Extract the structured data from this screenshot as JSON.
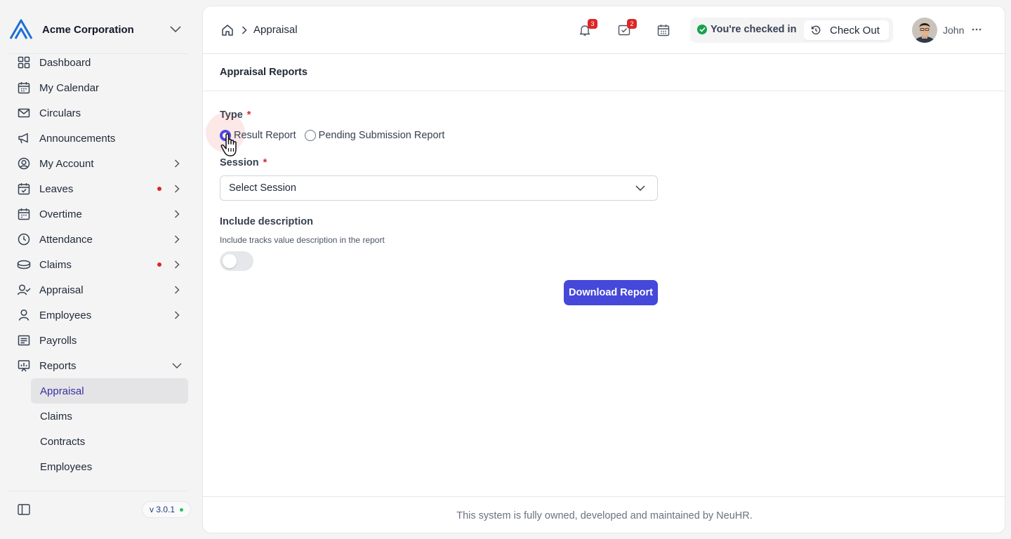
{
  "sidebar": {
    "org_name": "Acme Corporation",
    "items": [
      {
        "label": "Dashboard",
        "icon": "dashboard-icon"
      },
      {
        "label": "My Calendar",
        "icon": "calendar-icon"
      },
      {
        "label": "Circulars",
        "icon": "mail-icon"
      },
      {
        "label": "Announcements",
        "icon": "megaphone-icon"
      },
      {
        "label": "My Account",
        "icon": "user-circle-icon"
      },
      {
        "label": "Leaves",
        "icon": "calendar-check-icon"
      },
      {
        "label": "Overtime",
        "icon": "calendar-icon"
      },
      {
        "label": "Attendance",
        "icon": "clock-icon"
      },
      {
        "label": "Claims",
        "icon": "coins-icon"
      },
      {
        "label": "Appraisal",
        "icon": "user-check-icon"
      },
      {
        "label": "Employees",
        "icon": "user-icon"
      },
      {
        "label": "Payrolls",
        "icon": "receipt-icon"
      },
      {
        "label": "Reports",
        "icon": "presentation-chart-icon"
      }
    ],
    "report_subitems": [
      {
        "label": "Appraisal",
        "active": true
      },
      {
        "label": "Claims",
        "active": false
      },
      {
        "label": "Contracts",
        "active": false
      },
      {
        "label": "Employees",
        "active": false
      }
    ],
    "version": "v 3.0.1"
  },
  "topbar": {
    "breadcrumb": "Appraisal",
    "notifications_count": "3",
    "tasks_count": "2",
    "checkin_status": "You're checked in",
    "checkout_label": "Check Out",
    "user_name": "John"
  },
  "page": {
    "section_title": "Appraisal Reports",
    "type_label": "Type",
    "required_mark": "*",
    "type_options": [
      "Result Report",
      "Pending Submission Report"
    ],
    "selected_type": "Result Report",
    "session_label": "Session",
    "session_value": "Select Session",
    "include_desc_label": "Include description",
    "include_desc_hint": "Include tracks value description in the report",
    "include_desc_enabled": false,
    "download_label": "Download Report",
    "footer_text": "This system is fully owned, developed and maintained by NeuHR."
  },
  "colors": {
    "accent": "#4548d8",
    "badge": "#dc2626",
    "success": "#16a34a",
    "active_text": "#3730a3"
  }
}
